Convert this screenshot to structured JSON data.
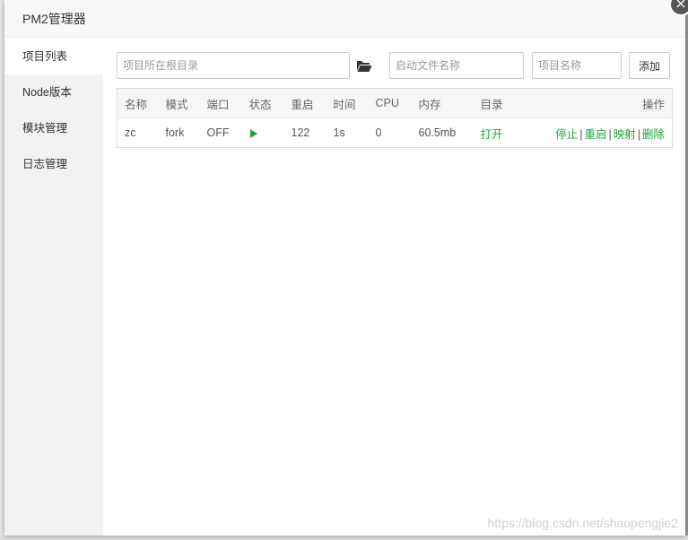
{
  "dialog": {
    "title": "PM2管理器",
    "close_label": "×"
  },
  "sidebar": {
    "items": [
      {
        "label": "项目列表",
        "active": true
      },
      {
        "label": "Node版本",
        "active": false
      },
      {
        "label": "模块管理",
        "active": false
      },
      {
        "label": "日志管理",
        "active": false
      }
    ]
  },
  "toolbar": {
    "path_placeholder": "项目所在根目录",
    "file_placeholder": "启动文件名称",
    "name_placeholder": "项目名称",
    "add_label": "添加"
  },
  "table": {
    "headers": [
      "名称",
      "模式",
      "端口",
      "状态",
      "重启",
      "时间",
      "CPU",
      "内存",
      "目录",
      "操作"
    ],
    "rows": [
      {
        "name": "zc",
        "mode": "fork",
        "port": "OFF",
        "status": "running",
        "restarts": "122",
        "time": "1s",
        "cpu": "0",
        "memory": "60.5mb",
        "dir_action": "打开",
        "ops": [
          "停止",
          "重启",
          "映射",
          "删除"
        ],
        "sep": "|"
      }
    ]
  },
  "watermark": "https://blog.csdn.net/shaopengjie2",
  "colors": {
    "accent_green": "#20a53a",
    "sidebar_bg": "#f2f2f2"
  }
}
